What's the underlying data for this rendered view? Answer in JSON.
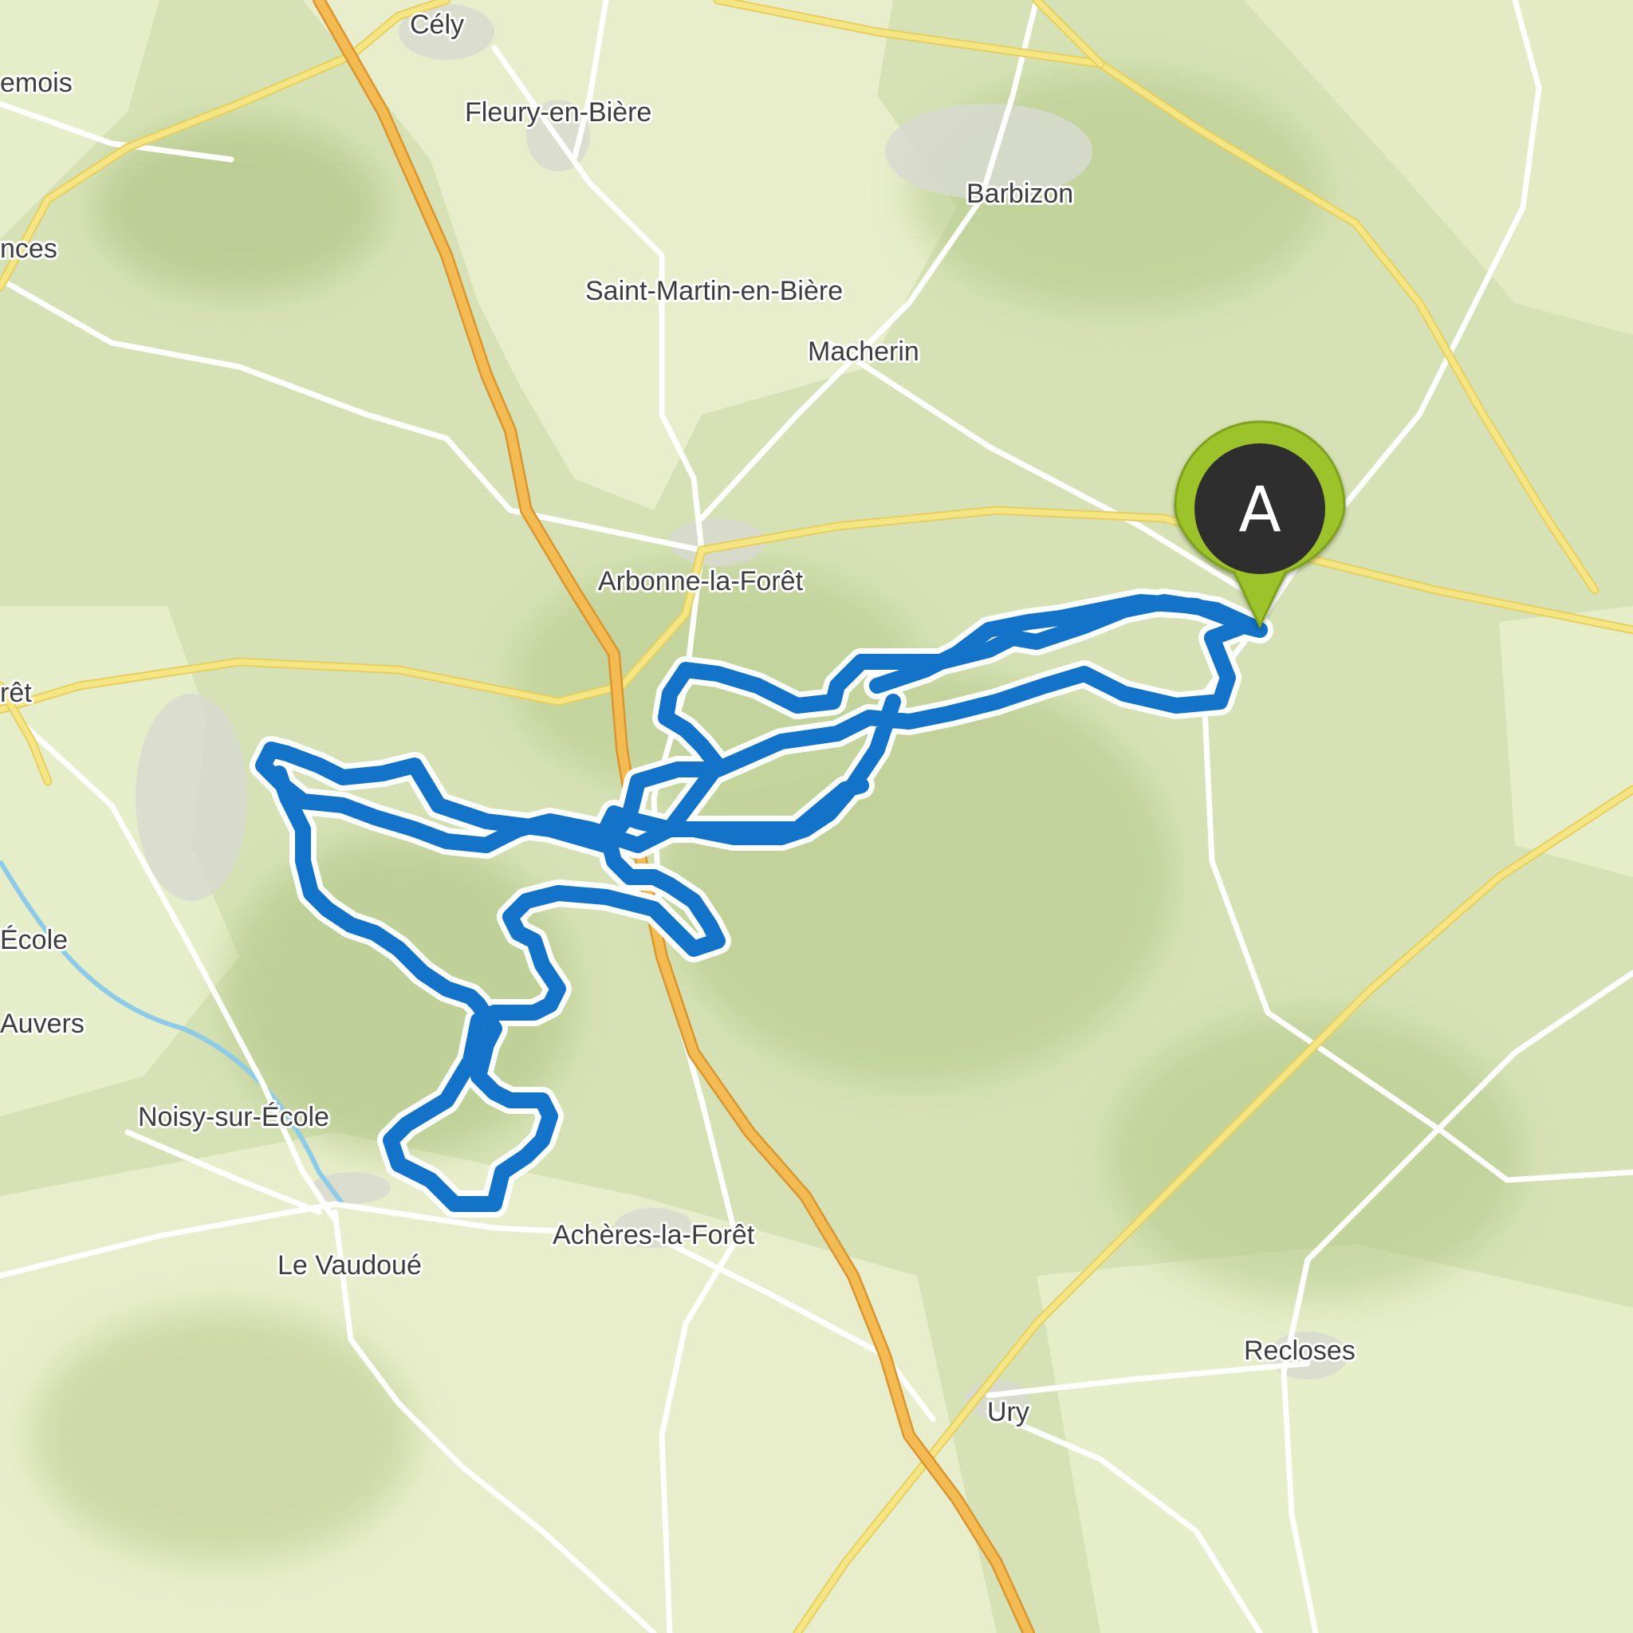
{
  "map": {
    "places": [
      {
        "id": "cely",
        "label": "Cély"
      },
      {
        "id": "xemois",
        "label": "emois"
      },
      {
        "id": "fleury",
        "label": "Fleury-en-Bière"
      },
      {
        "id": "barbizon",
        "label": "Barbizon"
      },
      {
        "id": "nces",
        "label": "nces"
      },
      {
        "id": "saint-martin",
        "label": "Saint-Martin-en-Bière"
      },
      {
        "id": "macherin",
        "label": "Macherin"
      },
      {
        "id": "arbonne",
        "label": "Arbonne-la-Forêt"
      },
      {
        "id": "ret",
        "label": "rêt"
      },
      {
        "id": "ecole",
        "label": "École"
      },
      {
        "id": "auvers",
        "label": "Auvers"
      },
      {
        "id": "noisy",
        "label": "Noisy-sur-École"
      },
      {
        "id": "acheres",
        "label": "Achères-la-Forêt"
      },
      {
        "id": "vaudoue",
        "label": "Le Vaudoué"
      },
      {
        "id": "recloses",
        "label": "Recloses"
      },
      {
        "id": "ury",
        "label": "Ury"
      }
    ],
    "start_marker": {
      "label": "A",
      "color": "#9cc32b",
      "inner_color": "#2f2f2f"
    },
    "route": {
      "color": "#1273c9"
    },
    "colors": {
      "forest": "#cbd9a3",
      "open_land": "#e9efcf",
      "major_road": "#f4e27a",
      "motorway": "#f2b64a",
      "minor_road": "#ffffff",
      "river": "#8ecbe8"
    }
  }
}
